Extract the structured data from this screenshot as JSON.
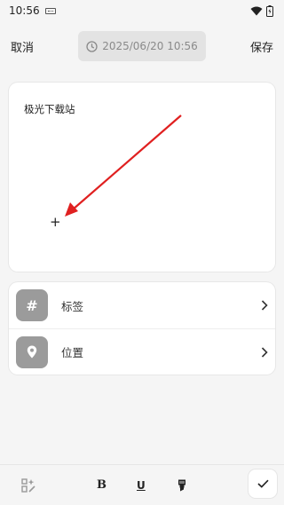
{
  "status_bar": {
    "time": "10:56"
  },
  "header": {
    "cancel_label": "取消",
    "datetime": "2025/06/20 10:56",
    "save_label": "保存"
  },
  "editor": {
    "content": "极光下载站",
    "cursor_glyph": "+"
  },
  "options": [
    {
      "label": "标签",
      "icon": "hash-icon"
    },
    {
      "label": "位置",
      "icon": "location-pin-icon"
    }
  ],
  "toolbar": {
    "bold_label": "B",
    "underline_label": "U"
  },
  "colors": {
    "annotation_arrow": "#e02020",
    "option_icon_bg": "#9b9b9b"
  }
}
